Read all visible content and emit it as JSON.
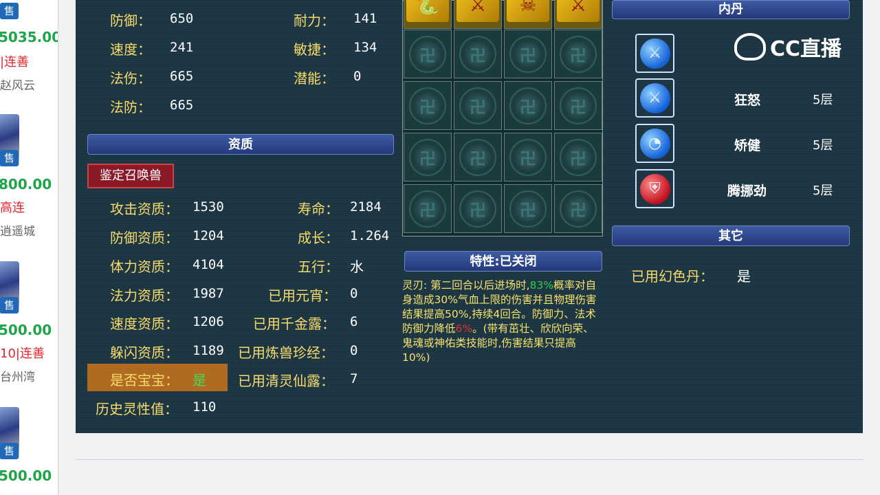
{
  "sidebar": {
    "sale_badge": "售",
    "listings": [
      {
        "price": "5035.00",
        "seller": "|连善",
        "server": "赵风云"
      },
      {
        "price": "800.00",
        "seller": "高连",
        "server": "逍遥城"
      },
      {
        "price": "500.00",
        "seller": "10|连善",
        "server": "台州湾"
      },
      {
        "price": "500.00",
        "seller": "",
        "server": ""
      }
    ]
  },
  "attributes": {
    "defense": {
      "label": "防御：",
      "value": "650"
    },
    "speed": {
      "label": "速度：",
      "value": "241"
    },
    "magic_damage": {
      "label": "法伤：",
      "value": "665"
    },
    "magic_defense": {
      "label": "法防：",
      "value": "665"
    },
    "endurance": {
      "label": "耐力：",
      "value": "141"
    },
    "agility": {
      "label": "敏捷：",
      "value": "134"
    },
    "potential": {
      "label": "潜能：",
      "value": "0"
    }
  },
  "aptitude": {
    "header": "资质",
    "identify_button": "鉴定召唤兽",
    "left": [
      {
        "label": "攻击资质：",
        "value": "1530"
      },
      {
        "label": "防御资质：",
        "value": "1204"
      },
      {
        "label": "体力资质：",
        "value": "4104"
      },
      {
        "label": "法力资质：",
        "value": "1987"
      },
      {
        "label": "速度资质：",
        "value": "1206"
      },
      {
        "label": "躲闪资质：",
        "value": "1189"
      }
    ],
    "right": [
      {
        "label": "寿命：",
        "value": "2184"
      },
      {
        "label": "成长：",
        "value": "1.264"
      },
      {
        "label": "五行：",
        "value": "水"
      },
      {
        "label": "已用元宵：",
        "value": "0"
      },
      {
        "label": "已用千金露：",
        "value": "6"
      },
      {
        "label": "已用炼兽珍经：",
        "value": "0"
      },
      {
        "label": "已用清灵仙露：",
        "value": "7"
      }
    ],
    "is_baby": {
      "label": "是否宝宝：",
      "value": "是"
    },
    "spirit_history": {
      "label": "历史灵性值：",
      "value": "110"
    }
  },
  "equipment": {
    "slot_symbol": "卍"
  },
  "trait": {
    "header": "特性:已关闭",
    "name": "灵刃:",
    "text_1": "第二回合以后进场时,",
    "chance": "83%",
    "text_2": "概率对自身造成30%气血上限的伤害并且物理伤害结果提高50%,持续4回合。防御力、法术防御力降低",
    "reduction": "6%",
    "text_3": "。(带有茁壮、欣欣向荣、鬼魂或神佑类技能时,伤害结果只提高10%)"
  },
  "neidan": {
    "header": "内丹",
    "skills": [
      {
        "name": "",
        "level": ""
      },
      {
        "name": "狂怒",
        "level": "5层"
      },
      {
        "name": "矫健",
        "level": "5层"
      },
      {
        "name": "腾挪劲",
        "level": "5层"
      }
    ]
  },
  "other": {
    "header": "其它",
    "illusion_dan": {
      "label": "已用幻色丹：",
      "value": "是"
    }
  },
  "watermark": "CC直播"
}
